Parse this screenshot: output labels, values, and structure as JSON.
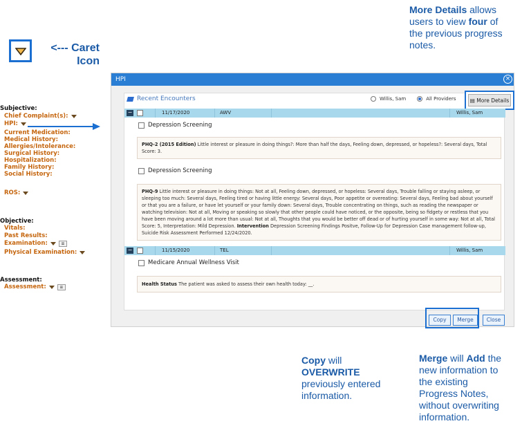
{
  "annotations": {
    "caret_label": "<--- Caret Icon",
    "more_details_title": "More Details",
    "more_details_rest_1": " allows users to view ",
    "more_details_bold_2": "four",
    "more_details_rest_2": " of the previous progress notes.",
    "copy_bold": "Copy",
    "copy_mid": " will ",
    "copy_bold_2": "OVERWRITE",
    "copy_rest": " previously entered information.",
    "merge_bold": "Merge",
    "merge_mid": " will ",
    "merge_bold_2": "Add",
    "merge_rest": " the new information to the existing Progress Notes, without overwriting information."
  },
  "outline": {
    "subjective": "Subjective:",
    "chief_complaint": "Chief Complaint(s):",
    "hpi": "HPI:",
    "current_medication": "Current Medication:",
    "medical_history": "Medical History:",
    "allergies": "Allergies/Intolerance:",
    "surgical_history": "Surgical History:",
    "hospitalization": "Hospitalization:",
    "family_history": "Family History:",
    "social_history": "Social History:",
    "ros": "ROS:",
    "objective": "Objective:",
    "vitals": "Vitals:",
    "past_results": "Past Results:",
    "examination": "Examination:",
    "physical_examination": "Physical Examination:",
    "assessment_section": "Assessment:",
    "assessment_item": "Assessment:"
  },
  "dialog": {
    "title": "HPI",
    "recent_encounters": "Recent Encounters",
    "radio_willis": "Willis, Sam",
    "radio_all": "All Providers",
    "more_details": "More Details",
    "encounters": [
      {
        "date": "11/17/2020",
        "type": "AWV",
        "provider": "Willis, Sam",
        "notes": [
          {
            "title": "Depression Screening",
            "label": "PHQ-2 (2015 Edition)",
            "text": " Little interest or pleasure in doing things?: More than half the days, Feeling down, depressed, or hopeless?: Several days, Total Score: 3."
          },
          {
            "title": "Depression Screening",
            "label": "PHQ-9",
            "text": " Little interest or pleasure in doing things: Not at all, Feeling down, depressed, or hopeless: Several days, Trouble falling or staying asleep, or sleeping too much: Several days, Feeling tired or having little energy: Several days, Poor appetite or overeating: Several days, Feeling bad about yourself or that you are a failure, or have let yourself or your family down: Several days, Trouble concentrating on things, such as reading the newspaper or watching television: Not at all, Moving or speaking so slowly that other people could have noticed, or the opposite, being so fidgety or restless that you have been moving around a lot more than usual: Not at all, Thoughts that you would be better off dead or of hurting yourself in some way: Not at all, Total Score: 5, Interpretation: Mild Depression. ",
            "label2": "Intervention",
            "text2": " Depression Screening Findings Positve, Follow-Up for Depression Case management follow-up, Suicide Risk Assessment Performed 12/24/2020."
          }
        ]
      },
      {
        "date": "11/15/2020",
        "type": "TEL",
        "provider": "Willis, Sam",
        "notes": [
          {
            "title": "Medicare Annual Wellness Visit",
            "label": "Health Status",
            "text": " The patient was asked to assess their own health today: __."
          }
        ]
      }
    ],
    "buttons": {
      "copy": "Copy",
      "merge": "Merge",
      "close": "Close"
    }
  },
  "colors": {
    "accent": "#1b6fd1",
    "title_bar": "#2a7fd4",
    "encounter_bar": "#a8d8ec",
    "outline_item": "#c5660f"
  },
  "icons": {
    "caret": "caret-down-icon",
    "close": "close-circle-icon",
    "more_details": "notes-icon"
  }
}
